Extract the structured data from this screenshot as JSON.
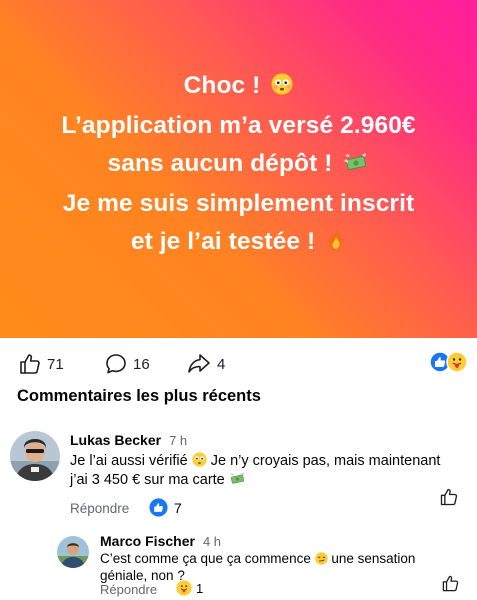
{
  "post": {
    "line1": "Choc !",
    "line2": "L’application m’a versé 2.960€",
    "line3": "sans aucun dépôt !",
    "line4": "Je me suis simplement inscrit",
    "line5": "et je l’ai testée !",
    "emoji": {
      "line1": "flushed-face",
      "line3": "money-with-wings",
      "line5": "fire"
    },
    "gradient": [
      "#ff8c19",
      "#ff5a52",
      "#ff1e9c"
    ]
  },
  "stats": {
    "likes": "71",
    "comments": "16",
    "shares": "4"
  },
  "comments_header": "Commentaires les plus récents",
  "comments": [
    {
      "author": "Lukas Becker",
      "time": "7 h",
      "text_line1": "Je l’ai aussi vérifié",
      "text_line1b": "Je n’y croyais pas, mais maintenant",
      "text_line2": "j’ai 3 450 € sur ma carte",
      "reply_label": "Répondre",
      "reaction_count": "7"
    },
    {
      "author": "Marco Fischer",
      "time": "4 h",
      "text_line1": "C’est comme ça que ça commence",
      "text_line1b": "une sensation",
      "text_line2": "géniale, non ?",
      "reply_label": "Répondre",
      "reaction_count": "1"
    }
  ],
  "colors": {
    "like_blue": "#1877f2",
    "muted": "#65676b"
  }
}
